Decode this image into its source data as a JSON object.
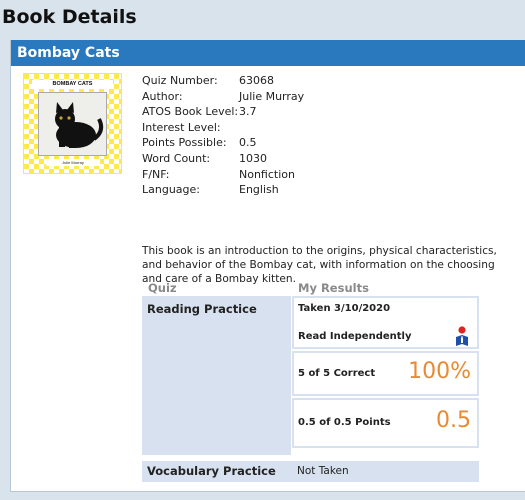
{
  "page_title": "Book Details",
  "book": {
    "title": "Bombay Cats",
    "cover": {
      "title_text": "BOMBAY CATS",
      "author_text": "Julie Murray"
    },
    "details": [
      {
        "label": "Quiz Number:",
        "value": "63068"
      },
      {
        "label": "Author:",
        "value": "Julie Murray"
      },
      {
        "label": "ATOS Book Level:",
        "value": "3.7"
      },
      {
        "label": "Interest Level:",
        "value": ""
      },
      {
        "label": "Points Possible:",
        "value": "0.5"
      },
      {
        "label": "Word Count:",
        "value": "1030"
      },
      {
        "label": "F/NF:",
        "value": "Nonfiction"
      },
      {
        "label": "Language:",
        "value": "English"
      }
    ],
    "description": "This book is an introduction to the origins, physical characteristics, and behavior of the Bombay cat, with information on the choosing and care of a Bombay kitten."
  },
  "results": {
    "quiz_header": "Quiz",
    "results_header": "My Results",
    "reading": {
      "name": "Reading Practice",
      "taken": "Taken 3/10/2020",
      "mode": "Read Independently",
      "correct_text": "5 of 5 Correct",
      "percent": "100%",
      "points_text": "0.5 of 0.5 Points",
      "points": "0.5"
    },
    "vocabulary": {
      "name": "Vocabulary Practice",
      "status": "Not Taken"
    }
  },
  "colors": {
    "header_blue": "#2a78bd",
    "accent_orange": "#e98a32",
    "row_blue": "#d8e1ef"
  },
  "icons": {
    "read_independently": "reader-icon"
  }
}
